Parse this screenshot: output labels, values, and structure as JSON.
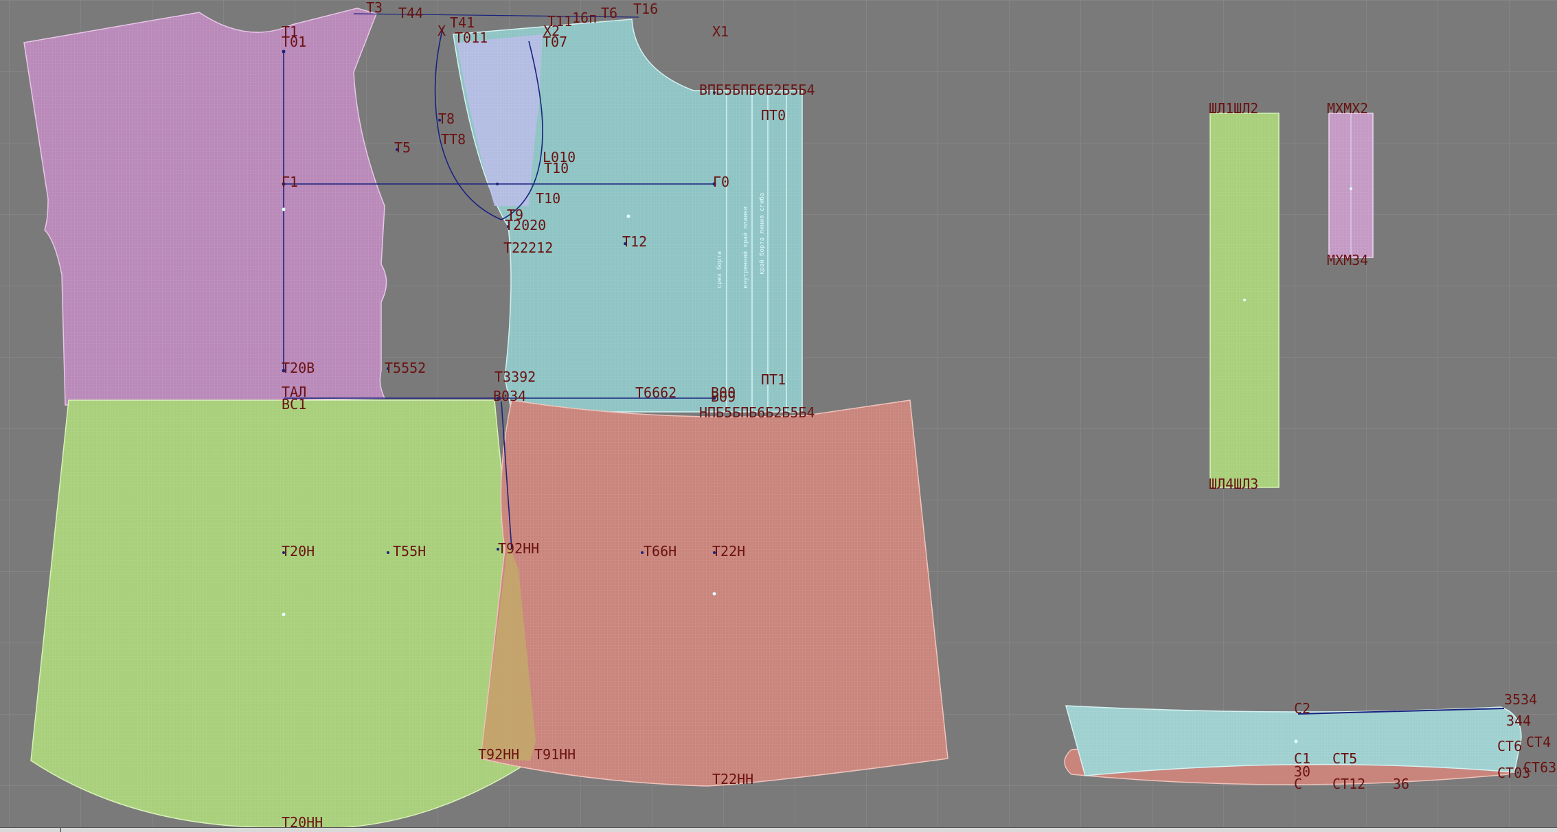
{
  "app": {
    "title": "",
    "grid": true
  },
  "colors": {
    "background": "#7a7a7a",
    "grid": "#8a8a8a",
    "back_bodice": "#b989b9",
    "front_bodice": "#8fc4c4",
    "front_overlay": "#b7bde6",
    "back_skirt": "#a8cf7a",
    "front_skirt": "#c9857c",
    "belt_loop": "#a8cf7a",
    "strap": "#c49ac4",
    "waistband": "#9fd0d0",
    "waistband_facing": "#c9857c",
    "construction_line": "#1a237e",
    "label_color": "#6a1212"
  },
  "pieces": [
    {
      "name": "back-bodice"
    },
    {
      "name": "front-bodice"
    },
    {
      "name": "back-skirt"
    },
    {
      "name": "front-skirt"
    },
    {
      "name": "belt-loop"
    },
    {
      "name": "strap"
    },
    {
      "name": "waistband"
    },
    {
      "name": "waistband-facing"
    }
  ],
  "labels": {
    "t1": "T1",
    "t01": "T01",
    "t3": "T3",
    "t44": "T44",
    "x_a": "X",
    "t41": "T41",
    "t011": "T011",
    "t11": "T11",
    "x2": "X2",
    "t16p": "16п",
    "t6": "T6",
    "t16": "T16",
    "t07": "T07",
    "x1": "X1",
    "vp_cluster": "ВПБ5БПБ6Б2Б5Б4",
    "pt0": "ПТ0",
    "t8": "T8",
    "tt8": "ТТ8",
    "t5": "T5",
    "l010": "L010",
    "t10": "T10",
    "g1": "Г1",
    "g0": "Г0",
    "t10b": "T10",
    "t9": "T9",
    "t20_cluster": "T2020",
    "t222": "T22212",
    "t12": "T12",
    "t20v": "T20B",
    "t552": "T5552",
    "t392": "T3392",
    "pt1": "ПТ1",
    "tal": "TАЛ",
    "vs1": "ВС1",
    "v0": "В034",
    "t662": "T6662",
    "v00": "В00",
    "vo9": "ВО9",
    "np_cluster": "НПБ5БПБ6Б2Б5Б4",
    "t20n": "T20H",
    "t55n": "T55H",
    "t92n": "T92HH",
    "t66n": "T66H",
    "t22n": "T22H",
    "t92nn": "T92HH",
    "t91nn": "T91HH",
    "t22nn": "T22HH",
    "t20nn": "T20HH",
    "shl12": "ШЛ1ШЛ2",
    "shl43": "ШЛ4ШЛ3",
    "mx12": "МХМХ2",
    "mx34": "МХМ34",
    "c2": "C2",
    "c3534": "3534",
    "c344": "З44",
    "c1": "C1",
    "ct5": "CT5",
    "c30": "30",
    "c": "C",
    "ct12": "CT12",
    "c36": "36",
    "ct6": "CТ6",
    "ct4": "CТ4",
    "ct63": "CТ63",
    "ct03": "CТ03",
    "v_text1": "срез борта",
    "v_text2": "внутренний край планки",
    "v_text3": "край борта линия сгиба"
  }
}
